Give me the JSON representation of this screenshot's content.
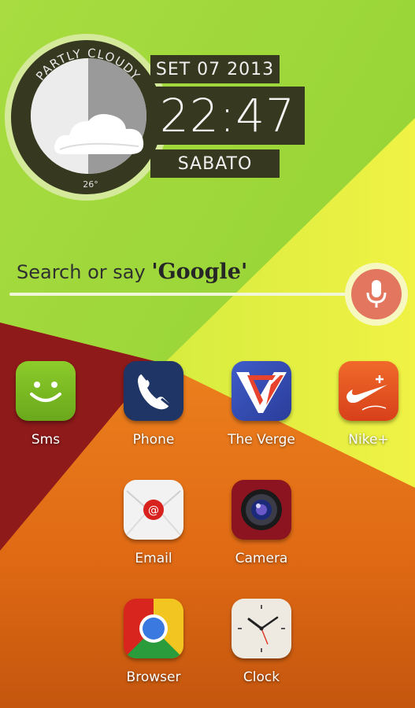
{
  "weather": {
    "condition": "PARTLY CLOUDY",
    "temperature": "26°",
    "icon": "partly-cloudy-icon"
  },
  "clock": {
    "date": "SET 07 2013",
    "time": "22:47",
    "day": "SABATO"
  },
  "search": {
    "prefix": "Search or say ",
    "brand": "'Google'",
    "mic_icon": "microphone-icon"
  },
  "apps": [
    {
      "label": "Sms",
      "icon": "sms-smiley-icon"
    },
    {
      "label": "Phone",
      "icon": "phone-handset-icon"
    },
    {
      "label": "The Verge",
      "icon": "the-verge-icon"
    },
    {
      "label": "Nike+",
      "icon": "nike-plus-icon"
    },
    {
      "label": "Email",
      "icon": "email-envelope-icon"
    },
    {
      "label": "Camera",
      "icon": "camera-lens-icon"
    },
    {
      "label": "Browser",
      "icon": "chrome-browser-icon"
    },
    {
      "label": "Clock",
      "icon": "analog-clock-icon"
    }
  ],
  "colors": {
    "wallpaper_green": "#9ed83a",
    "wallpaper_yellow": "#e8f040",
    "wallpaper_orange": "#e8761a",
    "wallpaper_red": "#8e1a1a",
    "widget_dark": "#36391f",
    "mic_red": "#e2765e"
  }
}
